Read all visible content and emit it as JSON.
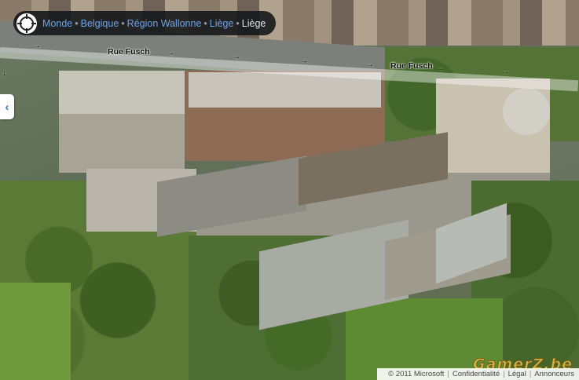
{
  "breadcrumb": {
    "items": [
      "Monde",
      "Belgique",
      "Région Wallonne",
      "Liège"
    ],
    "current": "Liège",
    "separator": "•",
    "link_color": "#6fa3e8"
  },
  "compass": {
    "icon": "compass-icon"
  },
  "streets": [
    {
      "name": "Rue Fusch"
    },
    {
      "name": "Rue Fusch"
    }
  ],
  "side_panel": {
    "icon": "chevron-left-icon",
    "glyph": "‹"
  },
  "footer": {
    "copyright": "© 2011 Microsoft",
    "links": [
      "Confidentialité",
      "Légal",
      "Annonceurs"
    ]
  },
  "watermark": "GamerZ.be"
}
